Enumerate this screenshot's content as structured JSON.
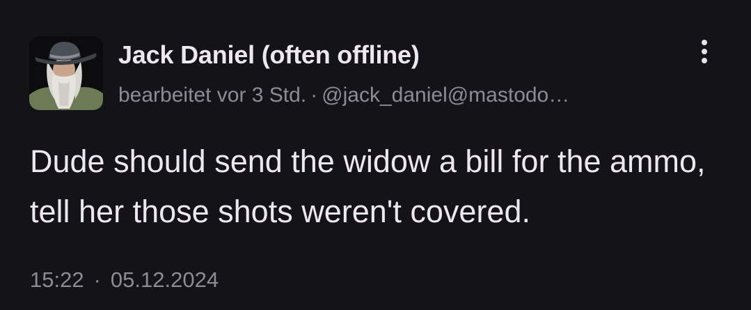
{
  "post": {
    "display_name": "Jack Daniel (often offline)",
    "edited_label": "bearbeitet vor 3 Std.",
    "separator": "·",
    "handle": "@jack_daniel@mastodo…",
    "content": "Dude should send the widow a bill for the ammo, tell her those shots weren't covered.",
    "time": "15:22",
    "date": "05.12.2024"
  },
  "icons": {
    "avatar": "avatar-image",
    "menu": "more-vertical-icon"
  },
  "colors": {
    "background": "#141318",
    "text": "#ece7f1",
    "muted_text": "#8f8b96"
  }
}
